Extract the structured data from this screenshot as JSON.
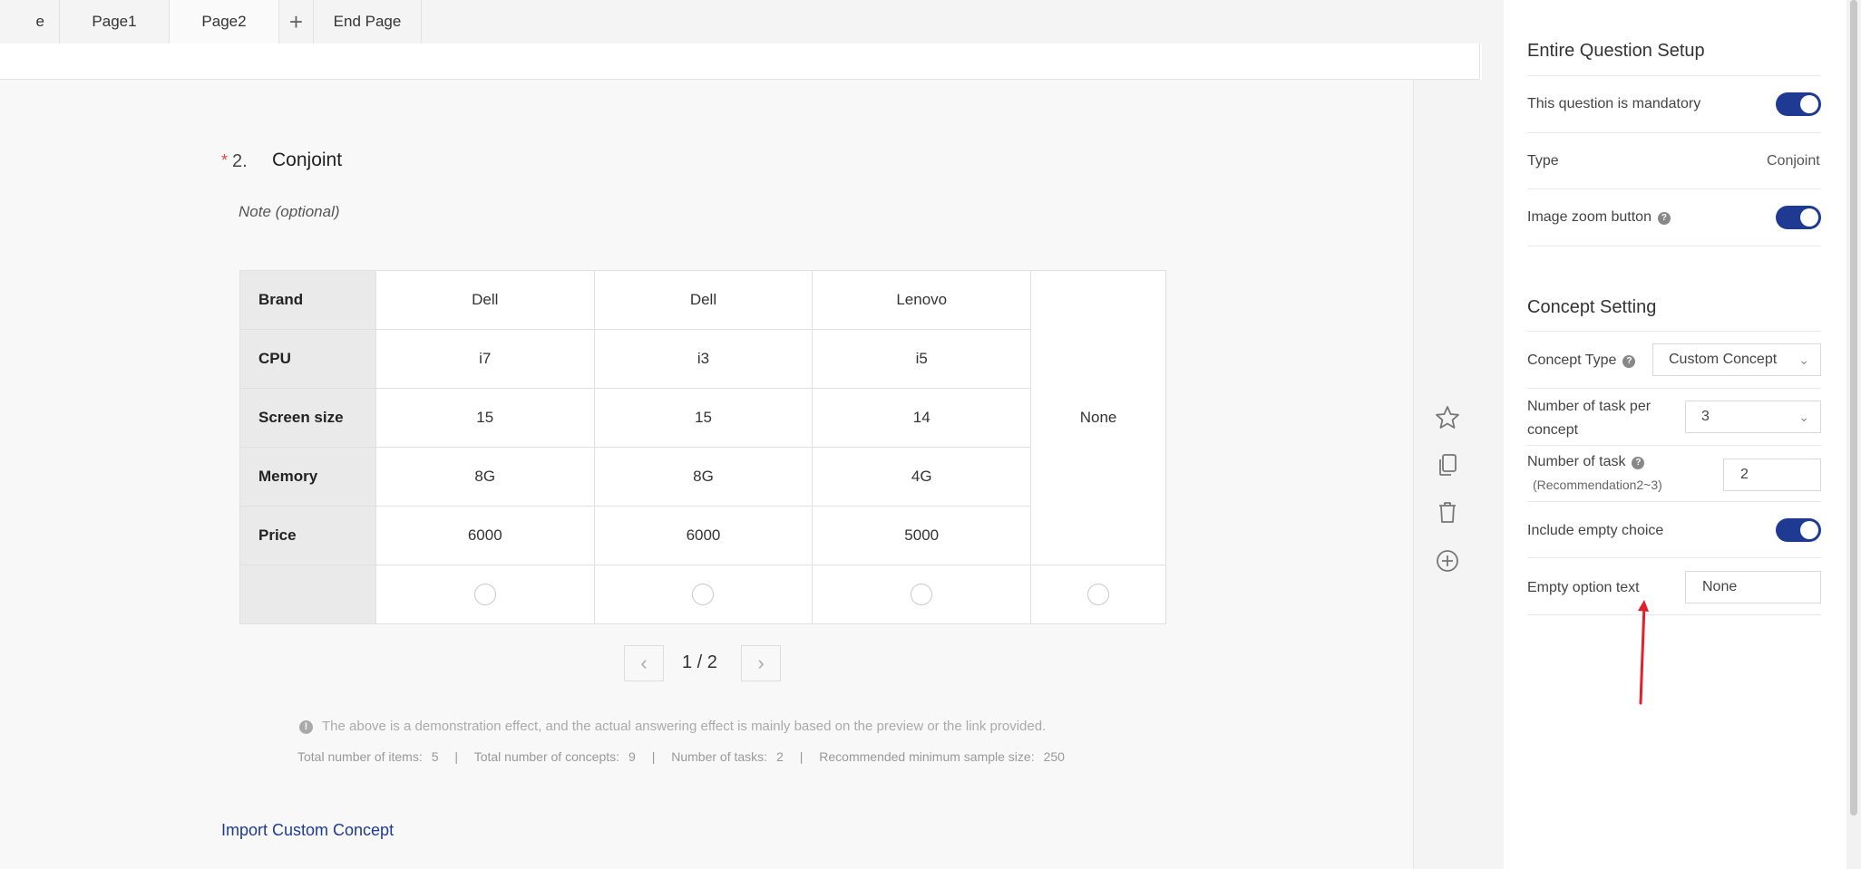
{
  "tabs": [
    {
      "label": "e Page"
    },
    {
      "label": "Page1"
    },
    {
      "label": "Page2"
    },
    {
      "label": "+"
    },
    {
      "label": "End Page"
    }
  ],
  "question": {
    "required_mark": "*",
    "number": "2.",
    "title": "Conjoint",
    "note": "Note (optional)"
  },
  "conjoint_table": {
    "attributes": [
      "Brand",
      "CPU",
      "Screen size",
      "Memory",
      "Price"
    ],
    "concepts": [
      [
        "Dell",
        "i7",
        "15",
        "8G",
        "6000"
      ],
      [
        "Dell",
        "i3",
        "15",
        "8G",
        "6000"
      ],
      [
        "Lenovo",
        "i5",
        "14",
        "4G",
        "5000"
      ]
    ],
    "none_label": "None"
  },
  "pager": {
    "prev": "‹",
    "text": "1 / 2",
    "next": "›"
  },
  "info": {
    "icon": "!",
    "message": "The above is a demonstration effect, and the actual answering effect is mainly based on the preview or the link provided."
  },
  "stats": {
    "items_label": "Total number of items:",
    "items_value": "5",
    "concepts_label": "Total number of concepts:",
    "concepts_value": "9",
    "tasks_label": "Number of tasks:",
    "tasks_value": "2",
    "sample_label": "Recommended minimum sample size:",
    "sample_value": "250",
    "separator": "|"
  },
  "import_link": "Import Custom Concept",
  "side_actions": [
    "star-icon",
    "copy-icon",
    "trash-icon",
    "add-circle-icon"
  ],
  "panel": {
    "section1_title": "Entire Question Setup",
    "mandatory_label": "This question is mandatory",
    "mandatory_on": true,
    "type_label": "Type",
    "type_value": "Conjoint",
    "zoom_label": "Image zoom button",
    "zoom_on": true,
    "section2_title": "Concept Setting",
    "concept_type_label": "Concept Type",
    "concept_type_value": "Custom Concept",
    "tasks_per_concept_label": "Number of task per concept",
    "tasks_per_concept_value": "3",
    "num_tasks_label": "Number of task",
    "num_tasks_hint": "(Recommendation2~3)",
    "num_tasks_value": "2",
    "empty_choice_label": "Include empty choice",
    "empty_choice_on": true,
    "empty_text_label": "Empty option text",
    "empty_text_value": "None",
    "help_glyph": "?"
  },
  "colors": {
    "accent": "#1f3a93",
    "required": "#e54545",
    "annotation_arrow": "#e0202a"
  }
}
